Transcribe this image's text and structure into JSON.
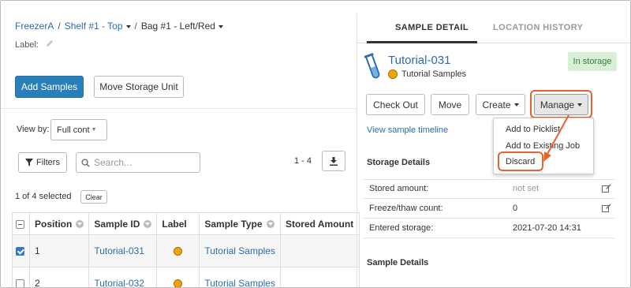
{
  "breadcrumb": {
    "items": [
      "FreezerA",
      "Shelf #1 - Top",
      "Bag #1 - Left/Red"
    ],
    "separator": "/"
  },
  "label_field": {
    "label": "Label:"
  },
  "toolbar": {
    "add_samples": "Add Samples",
    "move_storage_unit": "Move Storage Unit"
  },
  "view_by": {
    "label": "View by:",
    "selected": "Full cont"
  },
  "filters": {
    "label": "Filters"
  },
  "search": {
    "placeholder": "Search..."
  },
  "pager": {
    "range": "1 - 4"
  },
  "selection": {
    "text": "1 of 4 selected",
    "clear": "Clear"
  },
  "grid": {
    "columns": [
      "Position",
      "Sample ID",
      "Label",
      "Sample Type",
      "Stored Amount"
    ],
    "rows": [
      {
        "position": "1",
        "sample_id": "Tutorial-031",
        "sample_type": "Tutorial Samples",
        "checked": true
      },
      {
        "position": "2",
        "sample_id": "Tutorial-032",
        "sample_type": "Tutorial Samples",
        "checked": false
      }
    ]
  },
  "tabs": {
    "sample_detail": "SAMPLE DETAIL",
    "location_history": "LOCATION HISTORY"
  },
  "sample": {
    "name": "Tutorial-031",
    "type": "Tutorial Samples",
    "status": "In storage"
  },
  "actions": {
    "check_out": "Check Out",
    "move": "Move",
    "create": "Create",
    "manage": "Manage"
  },
  "manage_menu": [
    "Add to Picklist",
    "Add to Existing Job",
    "Discard"
  ],
  "timeline_link": "View sample timeline",
  "storage_details": {
    "title": "Storage Details",
    "rows": [
      {
        "label": "Stored amount:",
        "value": "not set"
      },
      {
        "label": "Freeze/thaw count:",
        "value": "0"
      },
      {
        "label": "Entered storage:",
        "value": "2021-07-20 14:31"
      }
    ]
  },
  "sample_details": {
    "title": "Sample Details"
  },
  "colors": {
    "primary": "#2980b9",
    "link": "#2b6cae",
    "highlight": "#e8622d",
    "status_bg": "#d8f0d6",
    "label_dot": "#f0a30a"
  }
}
